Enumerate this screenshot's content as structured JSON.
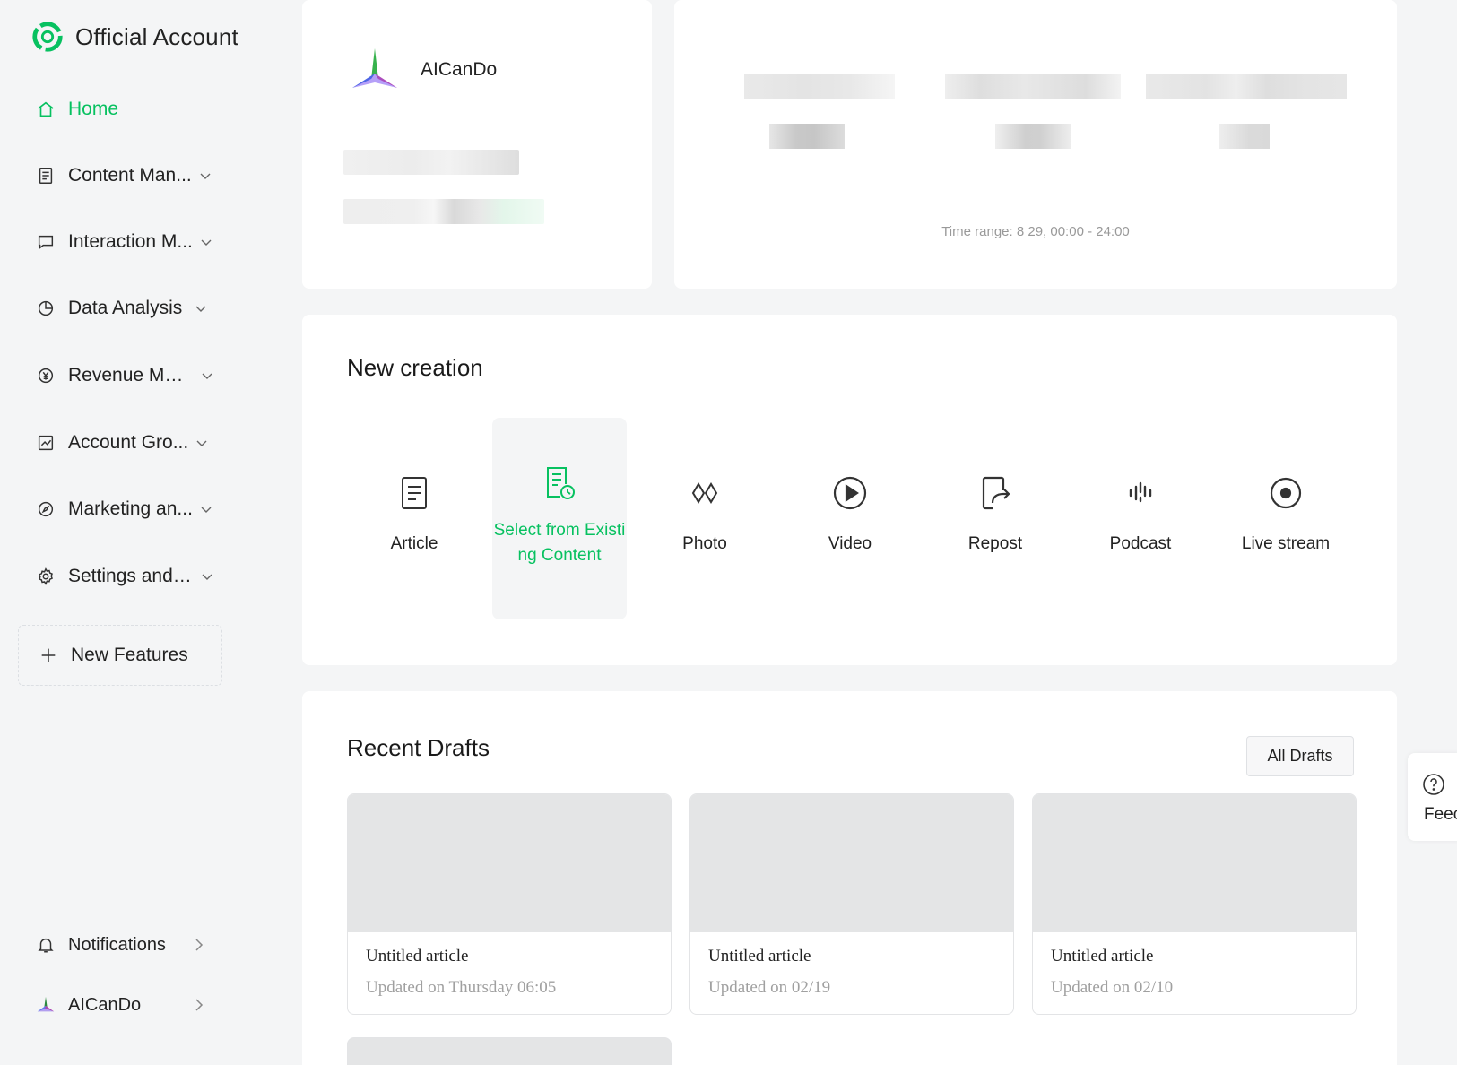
{
  "brand": {
    "title": "Official Account",
    "accent": "#07c160"
  },
  "nav": {
    "home": "Home",
    "content": "Content Man...",
    "interaction": "Interaction M...",
    "data": "Data Analysis",
    "revenue": "Revenue Mon...",
    "growth": "Account Gro...",
    "marketing": "Marketing an...",
    "settings": "Settings and ...",
    "new_features": "New Features"
  },
  "bottom": {
    "notifications": "Notifications",
    "account": "AICanDo"
  },
  "profile": {
    "name": "AICanDo"
  },
  "stats": {
    "time_range": "Time range: 8 29, 00:00 - 24:00"
  },
  "creation": {
    "title": "New creation",
    "items": [
      {
        "label": "Article",
        "icon": "article-icon"
      },
      {
        "label": "Select from Existing Content",
        "icon": "select-existing-icon"
      },
      {
        "label": "Photo",
        "icon": "photo-icon"
      },
      {
        "label": "Video",
        "icon": "video-icon"
      },
      {
        "label": "Repost",
        "icon": "repost-icon"
      },
      {
        "label": "Podcast",
        "icon": "podcast-icon"
      },
      {
        "label": "Live stream",
        "icon": "live-stream-icon"
      }
    ]
  },
  "drafts": {
    "title": "Recent Drafts",
    "all_label": "All Drafts",
    "items": [
      {
        "title": "Untitled article",
        "updated": "Updated on Thursday 06:05"
      },
      {
        "title": "Untitled article",
        "updated": "Updated on 02/19"
      },
      {
        "title": "Untitled article",
        "updated": "Updated on 02/10"
      }
    ]
  },
  "feedback": {
    "label": "Feec"
  }
}
